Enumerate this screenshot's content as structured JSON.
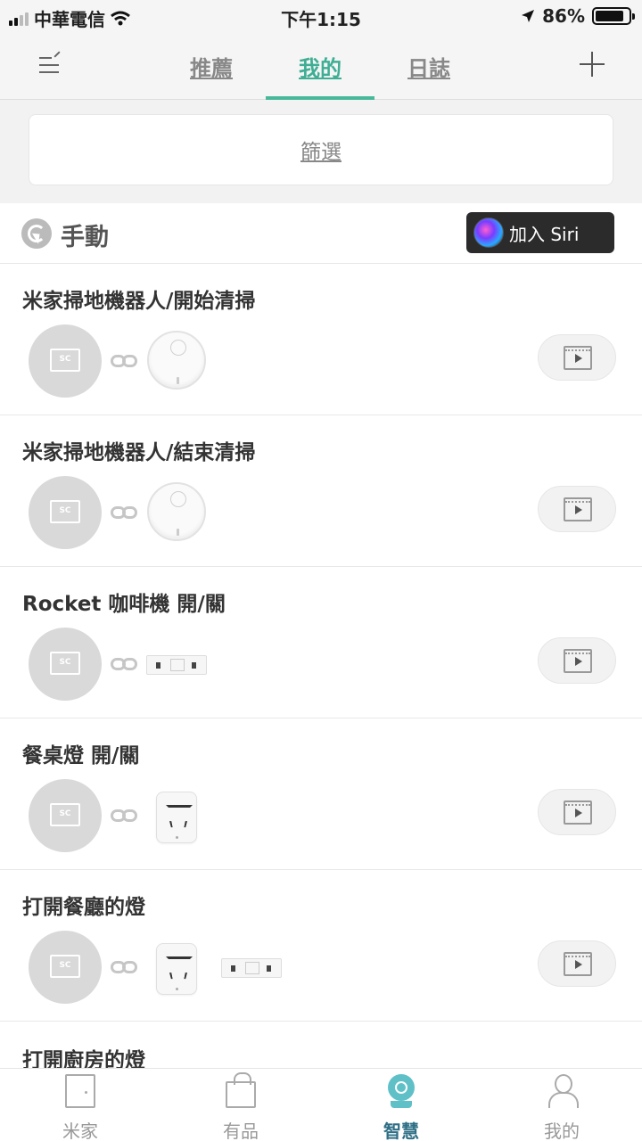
{
  "status_bar": {
    "carrier": "中華電信",
    "time": "下午1:15",
    "battery": "86%",
    "battery_level": 0.86,
    "icons": [
      "signal-icon",
      "wifi-icon",
      "location-icon",
      "battery-icon"
    ]
  },
  "top_nav": {
    "tabs": [
      {
        "label": "推薦",
        "active": false
      },
      {
        "label": "我的",
        "active": true
      },
      {
        "label": "日誌",
        "active": false
      }
    ],
    "accent": "#48b89a"
  },
  "filter": {
    "label": "篩選"
  },
  "section": {
    "label": "手動",
    "siri_button": "加入 Siri"
  },
  "scenes": [
    {
      "title": "米家掃地機器人/開始清掃",
      "devices": [
        "robot-vacuum-icon"
      ]
    },
    {
      "title": "米家掃地機器人/結束清掃",
      "devices": [
        "robot-vacuum-icon"
      ]
    },
    {
      "title": "Rocket 咖啡機 開/關",
      "devices": [
        "power-strip-icon"
      ]
    },
    {
      "title": "餐桌燈 開/關",
      "devices": [
        "smart-plug-icon"
      ]
    },
    {
      "title": "打開餐廳的燈",
      "devices": [
        "smart-plug-icon",
        "power-strip-icon"
      ]
    }
  ],
  "partial_scene": {
    "title": "打開廚房的燈"
  },
  "trigger_badge": "SC",
  "bottom_tabs": [
    {
      "label": "米家",
      "icon": "door-icon",
      "active": false
    },
    {
      "label": "有品",
      "icon": "shopping-bag-icon",
      "active": false
    },
    {
      "label": "智慧",
      "icon": "camera-icon",
      "active": true
    },
    {
      "label": "我的",
      "icon": "person-icon",
      "active": false
    }
  ]
}
